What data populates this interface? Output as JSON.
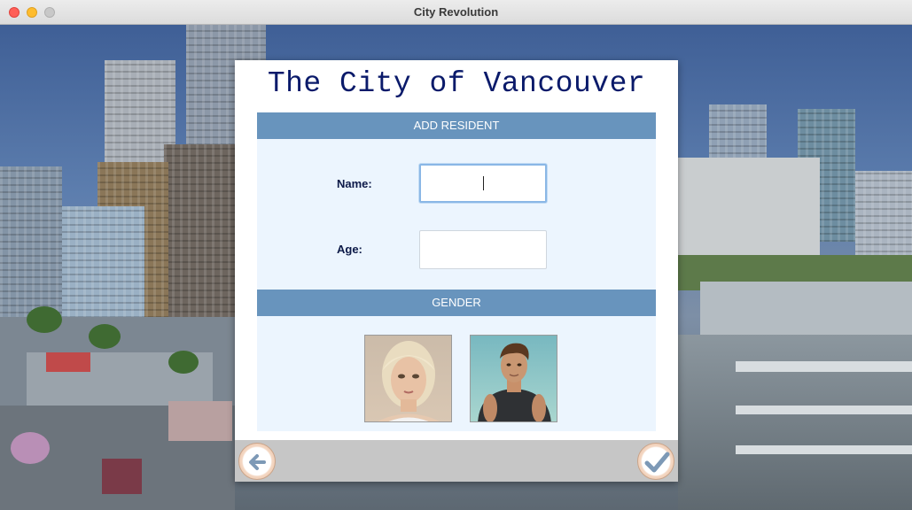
{
  "window": {
    "title": "City Revolution"
  },
  "dialog": {
    "title": "The City of Vancouver",
    "add_resident_header": "ADD RESIDENT",
    "name_label": "Name:",
    "name_value": "",
    "age_label": "Age:",
    "age_value": "",
    "gender_header": "GENDER"
  },
  "icons": {
    "back": "arrow-left-icon",
    "confirm": "checkmark-icon",
    "female": "female-avatar",
    "male": "male-avatar"
  },
  "colors": {
    "header_bar": "#6894bd",
    "panel_bg": "#ecf5fe",
    "title_text": "#0a1a6a"
  }
}
